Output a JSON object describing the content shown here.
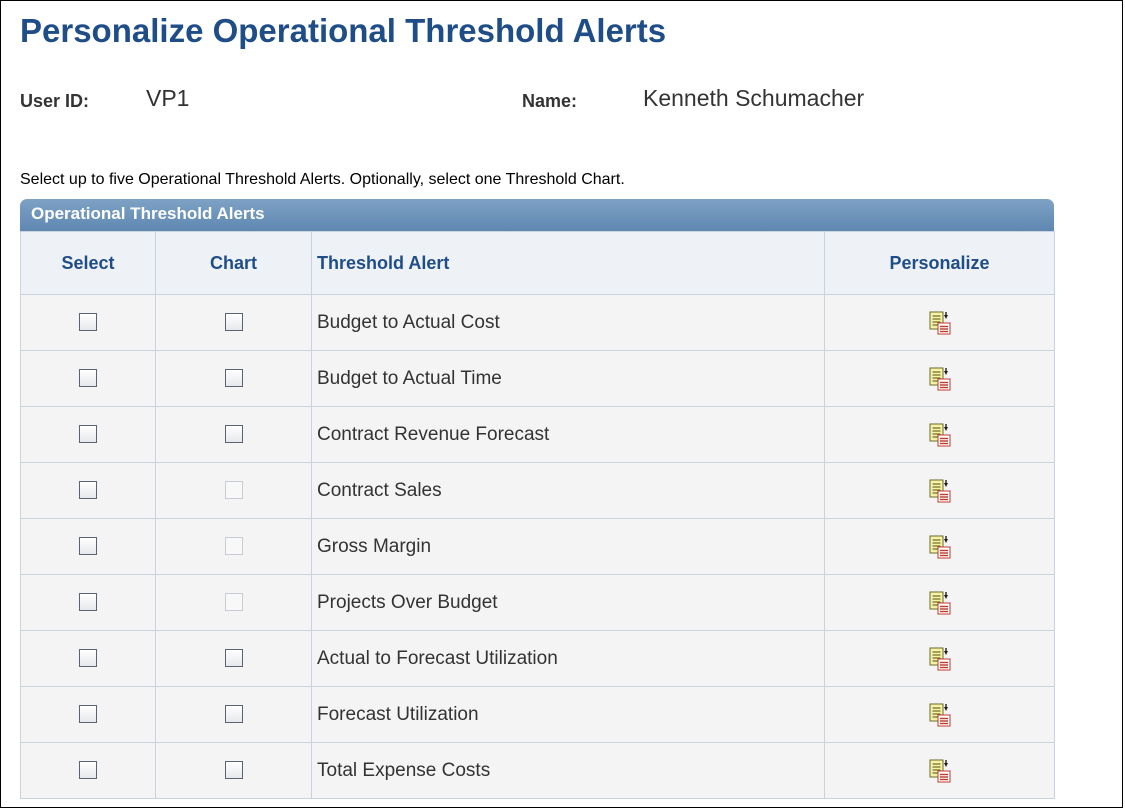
{
  "page": {
    "title": "Personalize Operational Threshold Alerts",
    "user_id_label": "User ID:",
    "user_id_value": "VP1",
    "name_label": "Name:",
    "name_value": "Kenneth Schumacher",
    "instructions": "Select up to five Operational Threshold Alerts. Optionally, select one Threshold Chart."
  },
  "grid": {
    "title": "Operational Threshold Alerts",
    "columns": {
      "select": "Select",
      "chart": "Chart",
      "alert": "Threshold Alert",
      "personalize": "Personalize"
    },
    "rows": [
      {
        "alert": "Budget to Actual Cost",
        "select_checked": false,
        "chart_checked": false,
        "chart_enabled": true
      },
      {
        "alert": "Budget to Actual Time",
        "select_checked": false,
        "chart_checked": false,
        "chart_enabled": true
      },
      {
        "alert": "Contract Revenue Forecast",
        "select_checked": false,
        "chart_checked": false,
        "chart_enabled": true
      },
      {
        "alert": "Contract Sales",
        "select_checked": false,
        "chart_checked": false,
        "chart_enabled": false
      },
      {
        "alert": "Gross Margin",
        "select_checked": false,
        "chart_checked": false,
        "chart_enabled": false
      },
      {
        "alert": "Projects Over Budget",
        "select_checked": false,
        "chart_checked": false,
        "chart_enabled": false
      },
      {
        "alert": "Actual to Forecast Utilization",
        "select_checked": false,
        "chart_checked": false,
        "chart_enabled": true
      },
      {
        "alert": "Forecast Utilization",
        "select_checked": false,
        "chart_checked": false,
        "chart_enabled": true
      },
      {
        "alert": "Total Expense Costs",
        "select_checked": false,
        "chart_checked": false,
        "chart_enabled": true
      }
    ]
  },
  "icons": {
    "personalize": "personalize-icon",
    "checkbox": "checkbox"
  },
  "colors": {
    "title": "#1f4d88",
    "grid_header": "#6f94bb",
    "column_header_text": "#1f4d88"
  }
}
